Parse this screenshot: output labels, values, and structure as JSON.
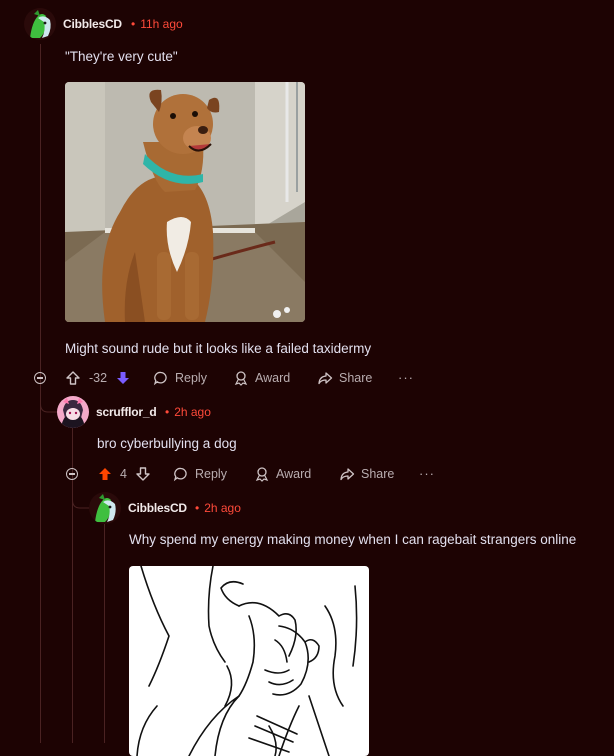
{
  "comments": [
    {
      "username": "CibblesCD",
      "time": "11h ago",
      "quote": "\"They're very cute\"",
      "text": "Might sound rude but it looks like a failed taxidermy",
      "score": "-32",
      "vote": "downvoted",
      "actions": {
        "reply": "Reply",
        "award": "Award",
        "share": "Share",
        "more": "···"
      }
    },
    {
      "username": "scrufflor_d",
      "time": "2h ago",
      "text": "bro cyberbullying a dog",
      "score": "4",
      "vote": "upvoted",
      "actions": {
        "reply": "Reply",
        "award": "Award",
        "share": "Share",
        "more": "···"
      }
    },
    {
      "username": "CibblesCD",
      "time": "2h ago",
      "text": "Why spend my energy making money when I can ragebait strangers online"
    }
  ],
  "colors": {
    "background": "#1d0303",
    "timestamp": "#ff4a3a",
    "upvote": "#ff4500",
    "downvote": "#7a5cff"
  }
}
